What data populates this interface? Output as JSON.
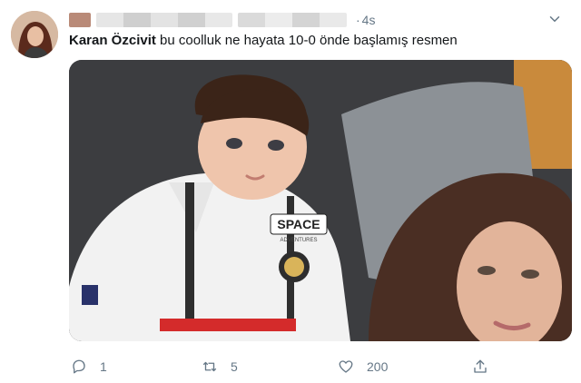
{
  "tweet": {
    "timestamp": "4s",
    "dot": "·",
    "mention": "Karan Özcivit",
    "text": " bu coolluk ne hayata 10-0 önde başlamış resmen"
  },
  "image": {
    "baby_shirt_text": "SPACE",
    "baby_shirt_subtext": "ADVENTURES"
  },
  "actions": {
    "reply_count": "1",
    "retweet_count": "5",
    "like_count": "200"
  },
  "icons": {
    "more": "chevron-down-icon",
    "reply": "reply-icon",
    "retweet": "retweet-icon",
    "like": "heart-icon",
    "share": "share-icon"
  },
  "colors": {
    "muted": "#657786",
    "text": "#14171a"
  }
}
